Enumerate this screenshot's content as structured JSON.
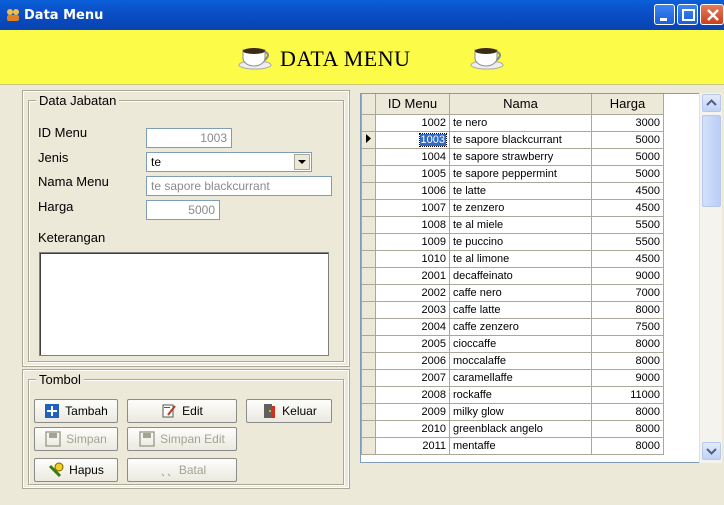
{
  "window": {
    "title": "Data Menu"
  },
  "header": {
    "title": "DATA MENU"
  },
  "form": {
    "group_label": "Data Jabatan",
    "id_label": "ID Menu",
    "id_value": "1003",
    "jenis_label": "Jenis",
    "jenis_value": "te",
    "nama_label": "Nama Menu",
    "nama_value": "te sapore blackcurrant",
    "harga_label": "Harga",
    "harga_value": "5000",
    "keterangan_label": "Keterangan"
  },
  "buttons": {
    "group_label": "Tombol",
    "tambah": "Tambah",
    "edit": "Edit",
    "keluar": "Keluar",
    "simpan": "Simpan",
    "simpan_edit": "Simpan Edit",
    "hapus": "Hapus",
    "batal": "Batal"
  },
  "grid": {
    "columns": [
      "ID Menu",
      "Nama",
      "Harga"
    ],
    "selected_index": 1,
    "rows": [
      [
        "1002",
        "te nero",
        "3000"
      ],
      [
        "1003",
        "te sapore blackcurrant",
        "5000"
      ],
      [
        "1004",
        "te sapore strawberry",
        "5000"
      ],
      [
        "1005",
        "te sapore peppermint",
        "5000"
      ],
      [
        "1006",
        "te latte",
        "4500"
      ],
      [
        "1007",
        "te zenzero",
        "4500"
      ],
      [
        "1008",
        "te al miele",
        "5500"
      ],
      [
        "1009",
        "te puccino",
        "5500"
      ],
      [
        "1010",
        "te al limone",
        "4500"
      ],
      [
        "2001",
        "decaffeinato",
        "9000"
      ],
      [
        "2002",
        "caffe nero",
        "7000"
      ],
      [
        "2003",
        "caffe latte",
        "8000"
      ],
      [
        "2004",
        "caffe zenzero",
        "7500"
      ],
      [
        "2005",
        "cioccaffe",
        "8000"
      ],
      [
        "2006",
        "moccalaffe",
        "8000"
      ],
      [
        "2007",
        "caramellaffe",
        "9000"
      ],
      [
        "2008",
        "rockaffe",
        "11000"
      ],
      [
        "2009",
        "milky glow",
        "8000"
      ],
      [
        "2010",
        "greenblack angelo",
        "8000"
      ],
      [
        "2011",
        "mentaffe",
        "8000"
      ]
    ]
  },
  "icons": [
    "app-icon",
    "coffee-cup-icon",
    "plus-icon",
    "edit-icon",
    "exit-door-icon",
    "disk-icon",
    "trash-icon",
    "undo-icon",
    "row-pointer-icon"
  ],
  "colors": {
    "titlebar": "#0b4fc8",
    "header_bg": "#fbfb48",
    "selection": "#316ac5",
    "window_bg": "#ece9d8"
  }
}
